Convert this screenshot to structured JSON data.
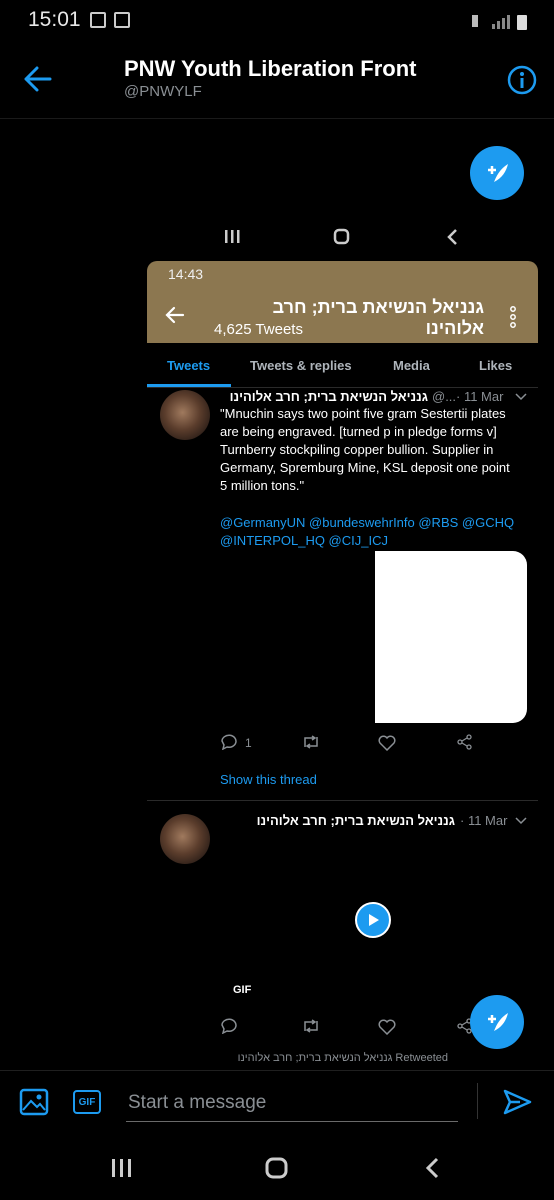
{
  "status_bar": {
    "time": "15:01"
  },
  "header": {
    "title": "PNW Youth Liberation Front",
    "handle": "@PNWYLF"
  },
  "embedded": {
    "status_time": "14:43",
    "profile_name": "גנניאל הנשיאת ברית; חרב אלוהינו",
    "tweet_count": "4,625 Tweets",
    "tabs": [
      {
        "label": "Tweets",
        "active": true
      },
      {
        "label": "Tweets & replies",
        "active": false
      },
      {
        "label": "Media",
        "active": false
      },
      {
        "label": "Likes",
        "active": false
      }
    ],
    "tweet1": {
      "name": "גנניאל הנשיאת ברית; חרב אלוהינו",
      "handle": "@...",
      "date": "· 11 Mar",
      "text": "\"Mnuchin says two point five gram Sestertii plates are being engraved. [turned p in pledge forms v] Turnberry stockpiling copper bullion. Supplier in Germany, Spremburg Mine, KSL deposit one point 5 million tons.\"",
      "mentions": "@GermanyUN @bundeswehrInfo @RBS @GCHQ @INTERPOL_HQ @CIJ_ICJ",
      "reply_count": "1",
      "show_thread": "Show this thread"
    },
    "tweet2": {
      "name": "גנניאל הנשיאת ברית; חרב אלוהינו",
      "date": "· 11 Mar",
      "gif_label": "GIF"
    },
    "retweeted_line": "Retweeted גנניאל הנשיאת ברית; חרב אלוהינו"
  },
  "composer": {
    "placeholder": "Start a message",
    "gif_button": "GIF"
  },
  "colors": {
    "accent": "#1d9bf0",
    "background": "#000000",
    "embedded_bar": "#8c7750"
  }
}
